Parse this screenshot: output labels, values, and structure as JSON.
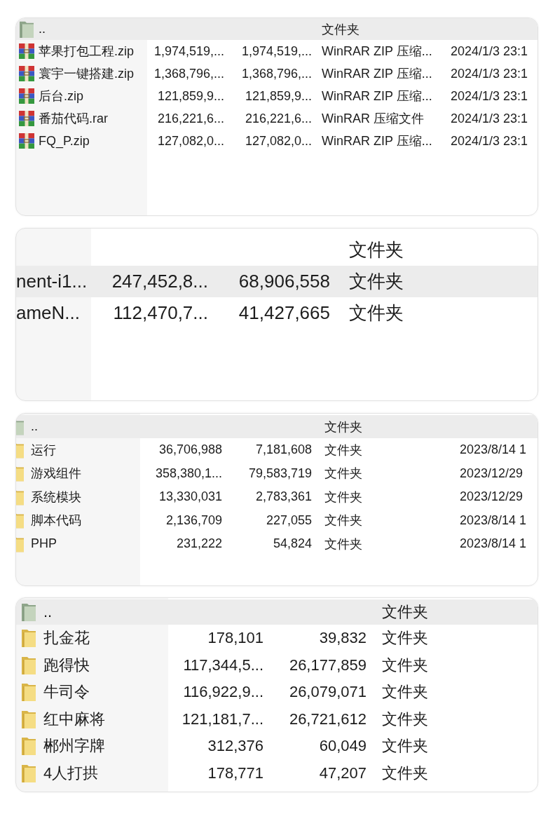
{
  "panels": [
    {
      "rows": [
        {
          "kind": "parent",
          "name": "..",
          "type": "文件夹",
          "selected": true
        },
        {
          "kind": "archive",
          "name": "苹果打包工程.zip",
          "size": "1,974,519,...",
          "packed": "1,974,519,...",
          "type": "WinRAR ZIP 压缩...",
          "modified": "2024/1/3 23:1",
          "selected": false
        },
        {
          "kind": "archive",
          "name": "寰宇一键搭建.zip",
          "size": "1,368,796,...",
          "packed": "1,368,796,...",
          "type": "WinRAR ZIP 压缩...",
          "modified": "2024/1/3 23:1",
          "selected": false
        },
        {
          "kind": "archive",
          "name": "后台.zip",
          "size": "121,859,9...",
          "packed": "121,859,9...",
          "type": "WinRAR ZIP 压缩...",
          "modified": "2024/1/3 23:1",
          "selected": false
        },
        {
          "kind": "archive",
          "name": "番茄代码.rar",
          "size": "216,221,6...",
          "packed": "216,221,6...",
          "type": "WinRAR 压缩文件",
          "modified": "2024/1/3 23:1",
          "selected": false
        },
        {
          "kind": "archive",
          "name": "FQ_P.zip",
          "size": "127,082,0...",
          "packed": "127,082,0...",
          "type": "WinRAR ZIP 压缩...",
          "modified": "2024/1/3 23:1",
          "selected": false
        }
      ]
    },
    {
      "rows": [
        {
          "kind": "entry",
          "type": "文件夹",
          "selected": false
        },
        {
          "kind": "entry",
          "name": "nent-i1...",
          "size": "247,452,8...",
          "packed": "68,906,558",
          "type": "文件夹",
          "selected": true
        },
        {
          "kind": "entry",
          "name": "ameN...",
          "size": "112,470,7...",
          "packed": "41,427,665",
          "type": "文件夹",
          "selected": false
        }
      ]
    },
    {
      "rows": [
        {
          "kind": "parent",
          "name": "..",
          "type": "文件夹",
          "selected": true
        },
        {
          "kind": "folder",
          "name": "运行",
          "size": "36,706,988",
          "packed": "7,181,608",
          "type": "文件夹",
          "modified": "2023/8/14 1",
          "selected": false
        },
        {
          "kind": "folder",
          "name": "游戏组件",
          "size": "358,380,1...",
          "packed": "79,583,719",
          "type": "文件夹",
          "modified": "2023/12/29",
          "selected": false
        },
        {
          "kind": "folder",
          "name": "系统模块",
          "size": "13,330,031",
          "packed": "2,783,361",
          "type": "文件夹",
          "modified": "2023/12/29",
          "selected": false
        },
        {
          "kind": "folder",
          "name": "脚本代码",
          "size": "2,136,709",
          "packed": "227,055",
          "type": "文件夹",
          "modified": "2023/8/14 1",
          "selected": false
        },
        {
          "kind": "folder",
          "name": "PHP",
          "size": "231,222",
          "packed": "54,824",
          "type": "文件夹",
          "modified": "2023/8/14 1",
          "selected": false
        }
      ]
    },
    {
      "rows": [
        {
          "kind": "parent",
          "name": "..",
          "type": "文件夹",
          "selected": true
        },
        {
          "kind": "folder",
          "name": "扎金花",
          "size": "178,101",
          "packed": "39,832",
          "type": "文件夹",
          "selected": false
        },
        {
          "kind": "folder",
          "name": "跑得快",
          "size": "117,344,5...",
          "packed": "26,177,859",
          "type": "文件夹",
          "selected": false
        },
        {
          "kind": "folder",
          "name": "牛司令",
          "size": "116,922,9...",
          "packed": "26,079,071",
          "type": "文件夹",
          "selected": false
        },
        {
          "kind": "folder",
          "name": "红中麻将",
          "size": "121,181,7...",
          "packed": "26,721,612",
          "type": "文件夹",
          "selected": false
        },
        {
          "kind": "folder",
          "name": "郴州字牌",
          "size": "312,376",
          "packed": "60,049",
          "type": "文件夹",
          "selected": false
        },
        {
          "kind": "folder",
          "name": "4人打拱",
          "size": "178,771",
          "packed": "47,207",
          "type": "文件夹",
          "selected": false
        }
      ]
    }
  ]
}
